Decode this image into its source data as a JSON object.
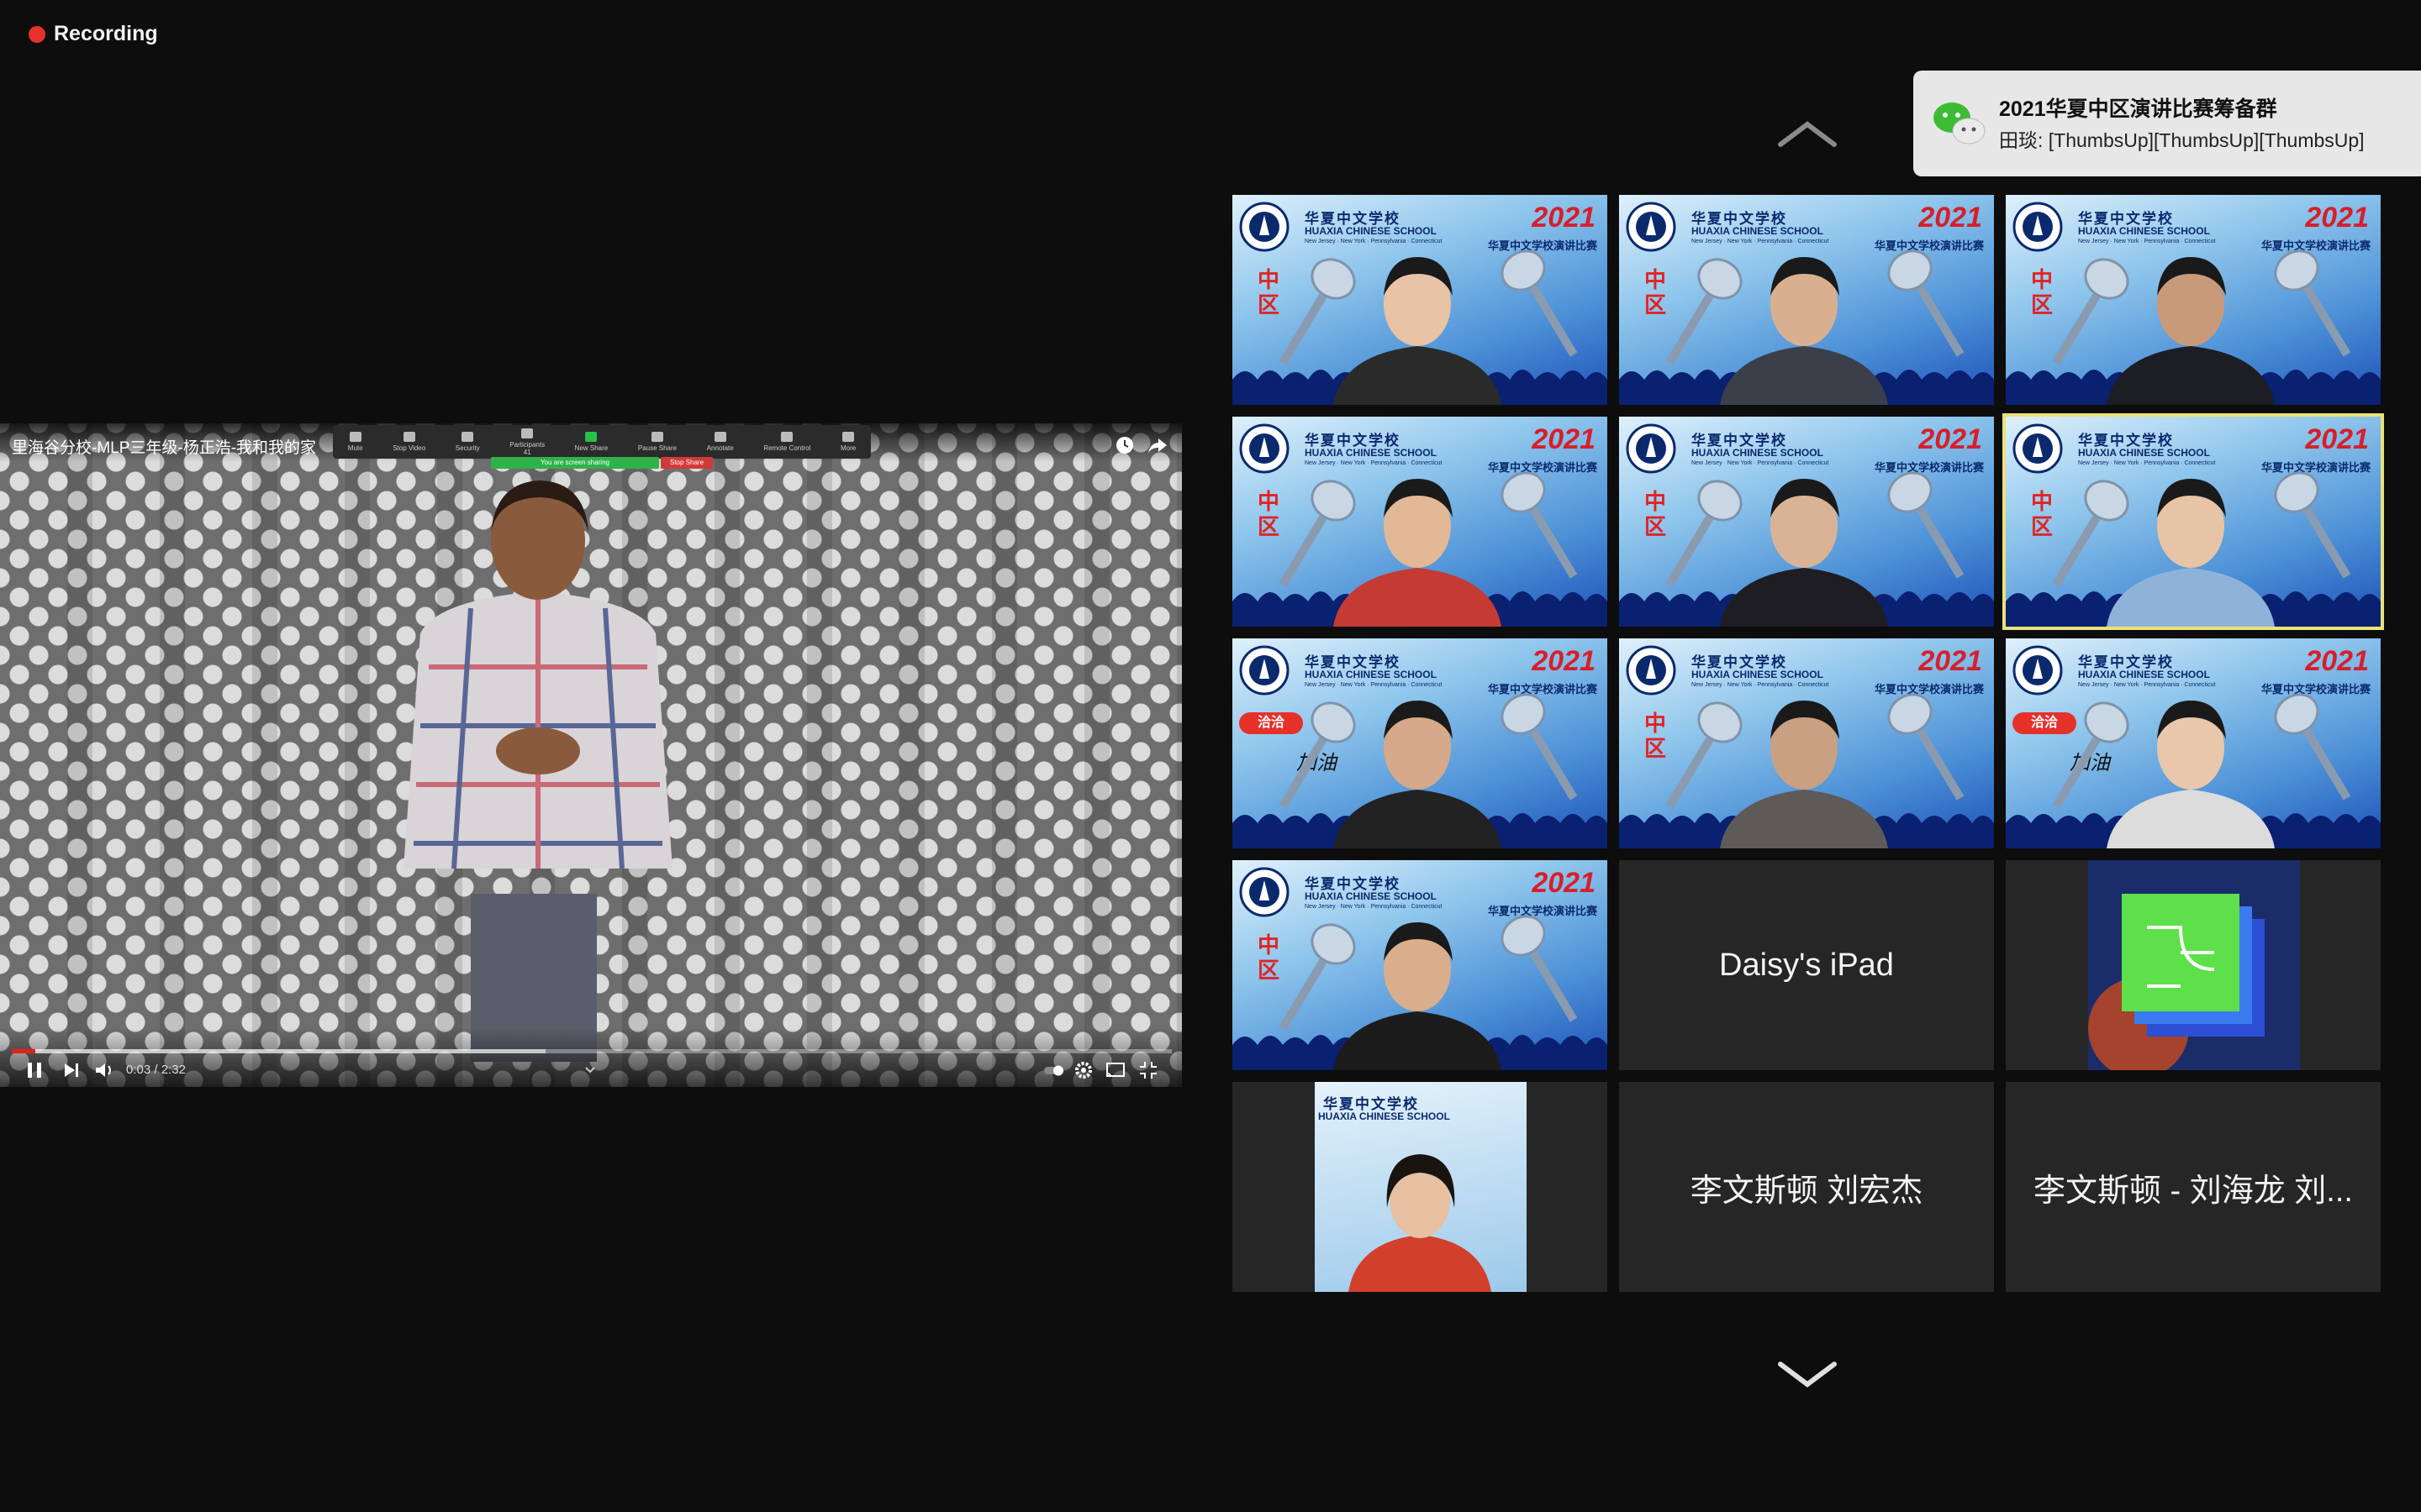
{
  "recording": {
    "label": "Recording"
  },
  "notification": {
    "app_icon": "wechat-icon",
    "title": "2021华夏中区演讲比赛筹备群",
    "message": "田琰: [ThumbsUp][ThumbsUp][ThumbsUp]"
  },
  "shared_screen": {
    "video_title": "里海谷分校-MLP三年级-杨正浩-我和我的家",
    "toolbar": [
      "Mute",
      "Stop Video",
      "Security",
      "Participants",
      "New Share",
      "Pause Share",
      "Annotate",
      "Remote Control",
      "More"
    ],
    "participants_count": "41",
    "sharing_banner": "You are screen sharing",
    "stop_share": "Stop Share",
    "player": {
      "current_time": "0:03",
      "duration": "2:32",
      "time_separator": "/",
      "progress_fraction": 0.02
    }
  },
  "school_bg": {
    "cn": "华夏中文学校",
    "en": "HUAXIA CHINESE SCHOOL",
    "sub": "New Jersey · New York · Pennsylvania · Connecticut",
    "year": "2021",
    "event": "华夏中文学校演讲比赛",
    "region": "中区",
    "badge": "洽洽",
    "cheer": "加油"
  },
  "gallery": {
    "tiles": [
      {
        "kind": "video",
        "bg": true
      },
      {
        "kind": "video",
        "bg": true
      },
      {
        "kind": "video",
        "bg": true
      },
      {
        "kind": "video",
        "bg": true
      },
      {
        "kind": "video",
        "bg": true
      },
      {
        "kind": "video",
        "bg": true,
        "active_speaker": true
      },
      {
        "kind": "video",
        "bg": true,
        "sponsor": true
      },
      {
        "kind": "video",
        "bg": true
      },
      {
        "kind": "video",
        "bg": true,
        "sponsor": true
      },
      {
        "kind": "video",
        "bg": true
      },
      {
        "kind": "name",
        "name": "Daisy's iPad"
      },
      {
        "kind": "avatar",
        "image": "abstract-logo-avatar"
      },
      {
        "kind": "cropped-video"
      },
      {
        "kind": "name",
        "name": "李文斯顿  刘宏杰"
      },
      {
        "kind": "name",
        "name": "李文斯顿 - 刘海龙 刘..."
      }
    ]
  },
  "colors": {
    "background": "#0d0d0d",
    "recording_red": "#e5322d",
    "active_outline": "#e9e27a",
    "tile": "#262626"
  }
}
